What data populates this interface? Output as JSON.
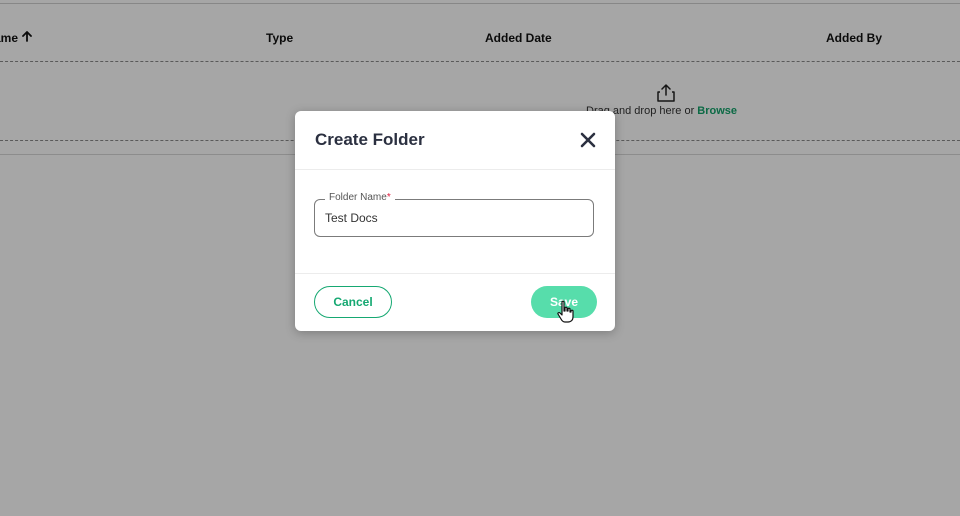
{
  "table": {
    "columns": [
      {
        "label": "ame",
        "sort_icon": "arrow-up-icon"
      },
      {
        "label": "Type"
      },
      {
        "label": "Added Date"
      },
      {
        "label": "Added By"
      }
    ]
  },
  "dropzone": {
    "icon": "upload-icon",
    "text": "Drag and drop here or ",
    "browse_label": "Browse",
    "link_color": "#13a36b"
  },
  "modal": {
    "title": "Create Folder",
    "close_icon": "close-icon",
    "field": {
      "label": "Folder Name",
      "required_mark": "*",
      "value": "Test Docs"
    },
    "cancel_label": "Cancel",
    "save_label": "Save",
    "accent_color": "#16a872",
    "save_color": "#57ddab"
  }
}
